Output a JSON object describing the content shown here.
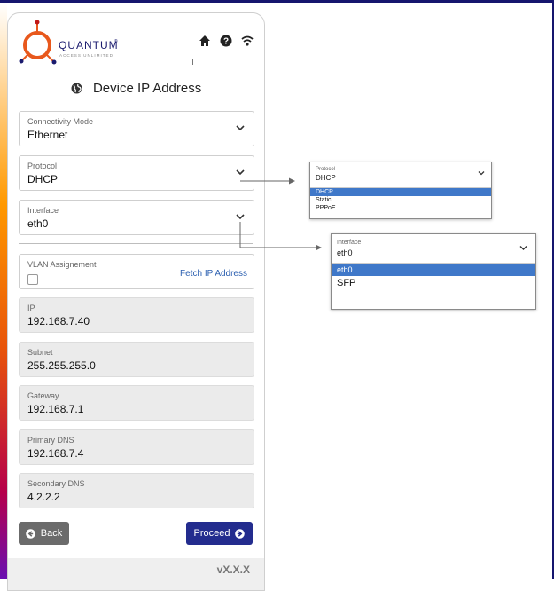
{
  "brand": {
    "name": "QUANTUM",
    "tagline": "ACCESS UNLIMITED",
    "trademark": "®"
  },
  "header": {
    "icons": [
      "home-icon",
      "help-icon",
      "wifi-icon"
    ]
  },
  "page": {
    "title": "Device IP Address",
    "title_icon": "globe-icon"
  },
  "form": {
    "connectivity_mode": {
      "label": "Connectivity Mode",
      "value": "Ethernet"
    },
    "protocol": {
      "label": "Protocol",
      "value": "DHCP"
    },
    "interface": {
      "label": "Interface",
      "value": "eth0"
    },
    "vlan": {
      "label": "VLAN Assignement",
      "checked": false,
      "fetch_label": "Fetch IP Address"
    },
    "ip": {
      "label": "IP",
      "value": "192.168.7.40"
    },
    "subnet": {
      "label": "Subnet",
      "value": "255.255.255.0"
    },
    "gateway": {
      "label": "Gateway",
      "value": "192.168.7.1"
    },
    "primary_dns": {
      "label": "Primary DNS",
      "value": "192.168.7.4"
    },
    "secondary_dns": {
      "label": "Secondary DNS",
      "value": "4.2.2.2"
    }
  },
  "buttons": {
    "back": "Back",
    "proceed": "Proceed"
  },
  "footer": {
    "version": "vX.X.X"
  },
  "protocol_dropdown": {
    "label": "Protocol",
    "value": "DHCP",
    "options": [
      "DHCP",
      "Static",
      "PPPoE"
    ],
    "selected": "DHCP"
  },
  "interface_dropdown": {
    "label": "Interface",
    "value": "eth0",
    "options": [
      "eth0",
      "SFP"
    ],
    "selected": "eth0"
  },
  "colors": {
    "accent": "#232c8e",
    "selected": "#3f78c9",
    "link": "#2b5fb0",
    "logo_orange": "#e8581c",
    "back_button": "#6b6b6b",
    "frame": "#15156e"
  }
}
